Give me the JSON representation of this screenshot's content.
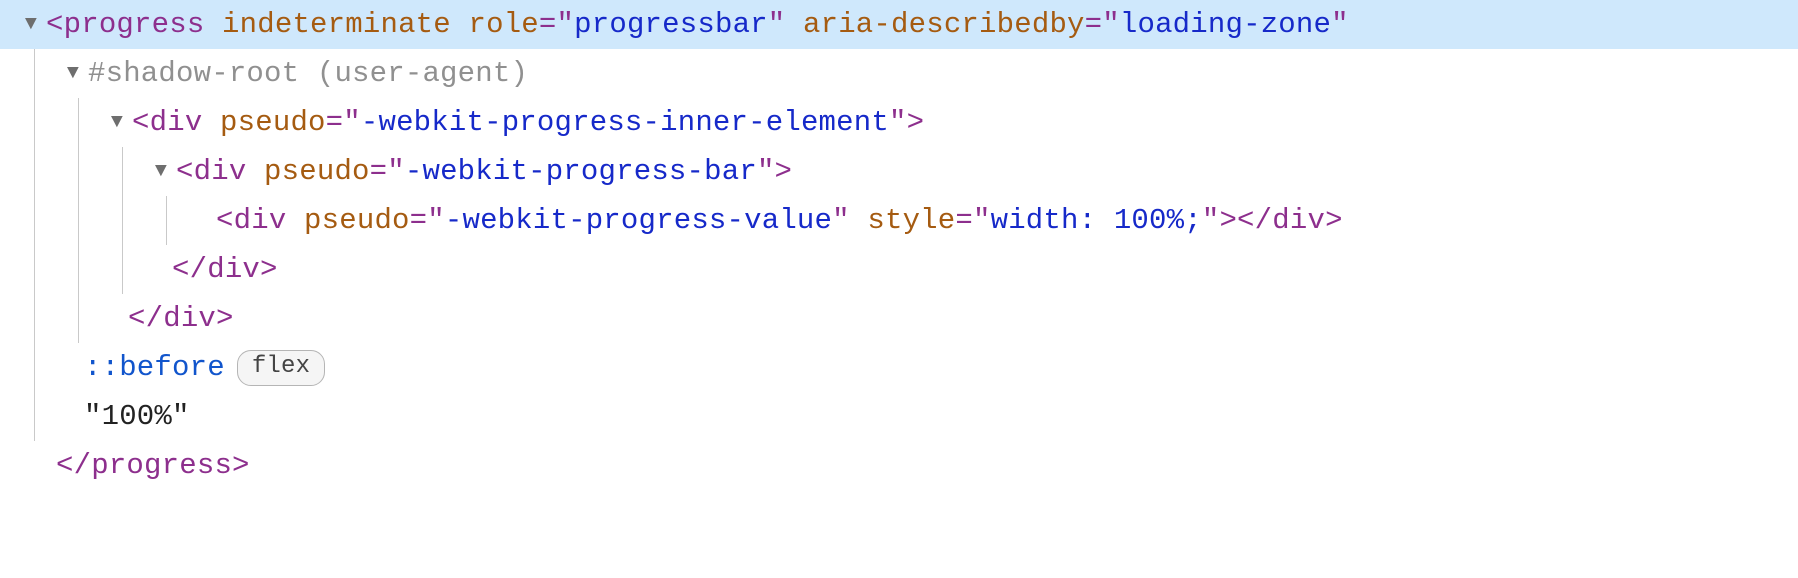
{
  "rows": {
    "r0": {
      "tag": "progress",
      "attrs": [
        {
          "name": "indeterminate",
          "value": null
        },
        {
          "name": "role",
          "value": "progressbar"
        },
        {
          "name": "aria-describedby",
          "value": "loading-zone"
        }
      ]
    },
    "r1": {
      "text": "#shadow-root (user-agent)"
    },
    "r2": {
      "tag": "div",
      "attr_name": "pseudo",
      "attr_value": "-webkit-progress-inner-element"
    },
    "r3": {
      "tag": "div",
      "attr_name": "pseudo",
      "attr_value": "-webkit-progress-bar"
    },
    "r4": {
      "tag": "div",
      "attr1_name": "pseudo",
      "attr1_value": "-webkit-progress-value",
      "attr2_name": "style",
      "attr2_value": "width: 100%;",
      "close_tag": "div"
    },
    "r5": {
      "close_tag": "div"
    },
    "r6": {
      "close_tag": "div"
    },
    "r7": {
      "selector": "::before",
      "badge": "flex"
    },
    "r8": {
      "text": "\"100%\""
    },
    "r9": {
      "close_tag": "progress"
    }
  },
  "glyphs": {
    "arrow_down": "▼"
  }
}
